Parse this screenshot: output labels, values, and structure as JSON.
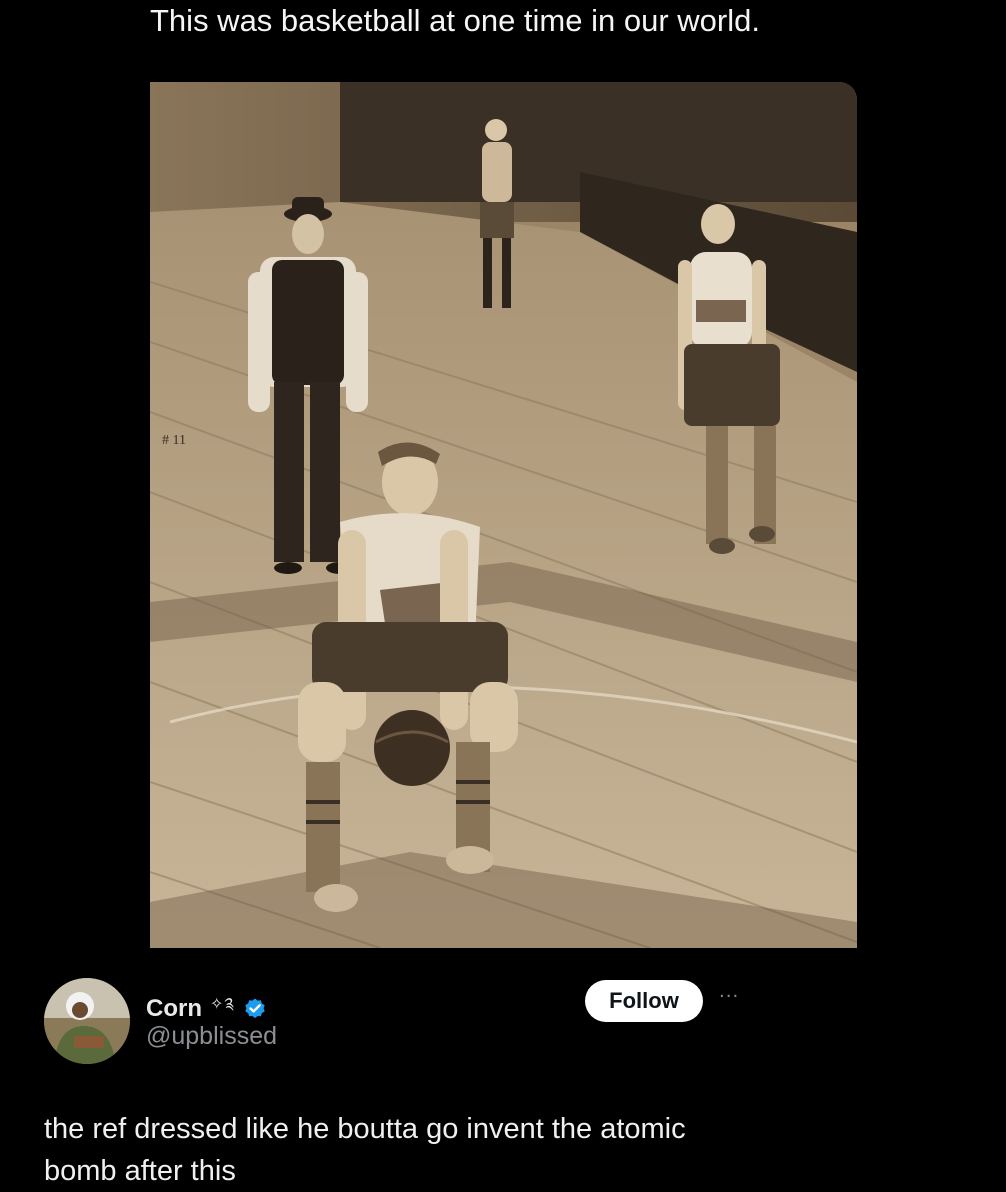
{
  "caption": "This was basketball at one time in our world.",
  "photo": {
    "description_icon": "vintage-basketball-photo",
    "corner_mark": "# 11"
  },
  "tweet": {
    "display_name": "Corn",
    "name_emoji": "✧༉",
    "handle": "@upblissed",
    "follow_label": "Follow",
    "more_label": "···",
    "text": "the ref dressed like he boutta go invent the atomic bomb after this",
    "verified_color": "#1d9bf0"
  }
}
